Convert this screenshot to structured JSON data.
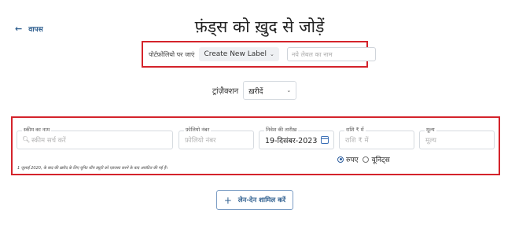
{
  "header": {
    "back_label": "वापस",
    "title": "फ़ंड्स को ख़ुद से जोड़ें"
  },
  "portfolio": {
    "label": "पोर्टफ़ोलियो पर जाएं",
    "selected": "Create New Label",
    "input_placeholder": "नये लेबल का नाम"
  },
  "transaction": {
    "label": "ट्रांज़ैक्शन",
    "selected": "ख़रीदें"
  },
  "entry": {
    "scheme": {
      "label": "स्कीम का नाम",
      "placeholder": "स्कीम सर्च करें"
    },
    "folio": {
      "label": "फ़ोलियो नंबर",
      "placeholder": "फ़ोलियो नंबर"
    },
    "date": {
      "label": "निवेश की तारीख़",
      "value": "19-दिसंबर-2023"
    },
    "amount": {
      "label": "राशि ₹ में",
      "placeholder": "राशि ₹ में"
    },
    "price": {
      "label": "मूल्य",
      "placeholder": "मूल्य"
    },
    "footnote": "1 जुलाई 2020, के बाद की ख़रीद के लिए यूनिट स्टैंप ड्यूटी को एडजस्ट करने के बाद आवंटित की गई हैं।",
    "unit_options": [
      {
        "label": "रुपए",
        "selected": true
      },
      {
        "label": "यूनिट्स",
        "selected": false
      }
    ]
  },
  "actions": {
    "add_transaction_label": "लेन-देन शामिल करें"
  }
}
